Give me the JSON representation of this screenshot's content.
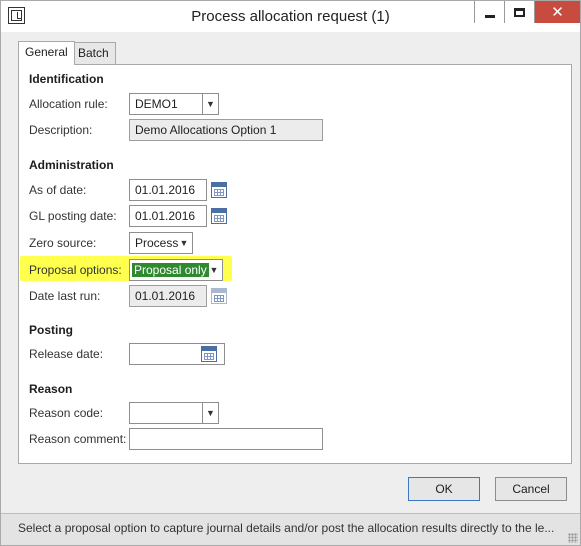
{
  "window": {
    "title": "Process allocation request (1)"
  },
  "tabs": [
    {
      "label": "General"
    },
    {
      "label": "Batch"
    }
  ],
  "identification": {
    "section_label": "Identification",
    "allocation_rule": {
      "label": "Allocation rule:",
      "value": "DEMO1"
    },
    "description": {
      "label": "Description:",
      "value": "Demo Allocations Option 1"
    }
  },
  "administration": {
    "section_label": "Administration",
    "as_of_date": {
      "label": "As of date:",
      "value": "01.01.2016"
    },
    "gl_posting_date": {
      "label": "GL posting date:",
      "value": "01.01.2016"
    },
    "zero_source": {
      "label": "Zero source:",
      "value": "Process"
    },
    "proposal_options": {
      "label": "Proposal options:",
      "value": "Proposal only"
    },
    "date_last_run": {
      "label": "Date last run:",
      "value": "01.01.2016"
    }
  },
  "posting": {
    "section_label": "Posting",
    "release_date": {
      "label": "Release date:",
      "value": ""
    }
  },
  "reason": {
    "section_label": "Reason",
    "reason_code": {
      "label": "Reason code:",
      "value": ""
    },
    "reason_comment": {
      "label": "Reason comment:",
      "value": ""
    }
  },
  "buttons": {
    "ok": "OK",
    "cancel": "Cancel"
  },
  "status": {
    "text": "Select a proposal option to capture journal details and/or post the allocation results directly to the le..."
  },
  "icons": {
    "app": "app-icon",
    "minimize": "minimize-icon",
    "maximize": "maximize-icon",
    "close": "close-icon",
    "dropdown": "chevron-down-icon",
    "calendar": "calendar-icon",
    "grip": "resize-grip-icon"
  },
  "colors": {
    "highlight": "#ffff4d",
    "selection": "#2f8a2f",
    "close_button": "#c74b3f",
    "calendar": "#4a6fa5"
  }
}
